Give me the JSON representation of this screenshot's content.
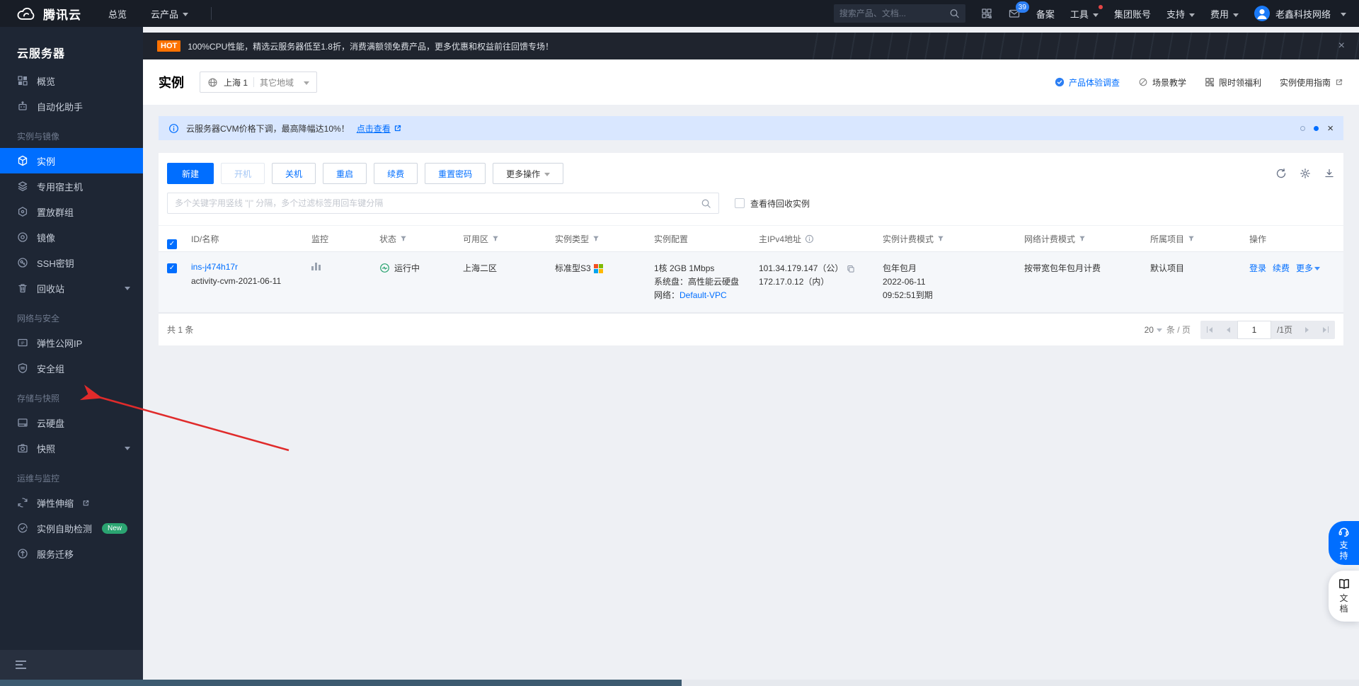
{
  "topbar": {
    "brand": "腾讯云",
    "nav_overview": "总览",
    "nav_products": "云产品",
    "search_placeholder": "搜索产品、文档...",
    "mail_badge": "39",
    "beian": "备案",
    "tools": "工具",
    "group_account": "集团账号",
    "support": "支持",
    "billing": "费用",
    "account_name": "老鑫科技网络"
  },
  "sidebar": {
    "title": "云服务器",
    "sections": [
      "实例与镜像",
      "网络与安全",
      "存储与快照",
      "运维与监控"
    ],
    "items": [
      {
        "label": "概览"
      },
      {
        "label": "自动化助手"
      },
      {
        "label": "实例"
      },
      {
        "label": "专用宿主机"
      },
      {
        "label": "置放群组"
      },
      {
        "label": "镜像"
      },
      {
        "label": "SSH密钥"
      },
      {
        "label": "回收站"
      },
      {
        "label": "弹性公网IP"
      },
      {
        "label": "安全组"
      },
      {
        "label": "云硬盘"
      },
      {
        "label": "快照"
      },
      {
        "label": "弹性伸缩"
      },
      {
        "label": "实例自助检测",
        "badge": "New"
      },
      {
        "label": "服务迁移"
      }
    ]
  },
  "promo": {
    "tag": "HOT",
    "text": "100%CPU性能，精选云服务器低至1.8折，消费满额领免费产品，更多优惠和权益前往回馈专场！",
    "close": "×"
  },
  "page_header": {
    "title": "实例",
    "region": "上海 1",
    "region_other": "其它地域",
    "link_survey": "产品体验调查",
    "link_teaching": "场景教学",
    "link_benefit": "限时领福利",
    "link_guide": "实例使用指南"
  },
  "notice": {
    "text": "云服务器CVM价格下调，最高降幅达10%！",
    "link": "点击查看",
    "close": "×"
  },
  "toolbar": {
    "create": "新建",
    "power_on": "开机",
    "shutdown": "关机",
    "restart": "重启",
    "renew": "续费",
    "reset_password": "重置密码",
    "more": "更多操作"
  },
  "filterbar": {
    "placeholder": "多个关键字用竖线 \"|\" 分隔，多个过滤标签用回车键分隔",
    "recycle": "查看待回收实例"
  },
  "table": {
    "columns": [
      "ID/名称",
      "监控",
      "状态",
      "可用区",
      "实例类型",
      "实例配置",
      "主IPv4地址",
      "实例计费模式",
      "网络计费模式",
      "所属项目",
      "操作"
    ],
    "row": {
      "id": "ins-j474h17r",
      "name": "activity-cvm-2021-06-11",
      "status": "运行中",
      "zone": "上海二区",
      "type": "标准型S3",
      "config_line1": "1核 2GB 1Mbps",
      "config_line2": "系统盘：高性能云硬盘",
      "config_net_label": "网络：",
      "config_vpc": "Default-VPC",
      "ip_public": "101.34.179.147（公）",
      "ip_private": "172.17.0.12（内）",
      "billing_mode": "包年包月",
      "billing_date": "2022-06-11",
      "billing_expire": "09:52:51到期",
      "network_billing": "按带宽包年包月计费",
      "project": "默认项目",
      "op_login": "登录",
      "op_renew": "续费",
      "op_more": "更多"
    }
  },
  "pagination": {
    "total": "共 1 条",
    "page_size": "20",
    "unit": "条 / 页",
    "current": "1",
    "pages": "/1页"
  },
  "floating": {
    "support": "支持",
    "docs": "文档"
  }
}
